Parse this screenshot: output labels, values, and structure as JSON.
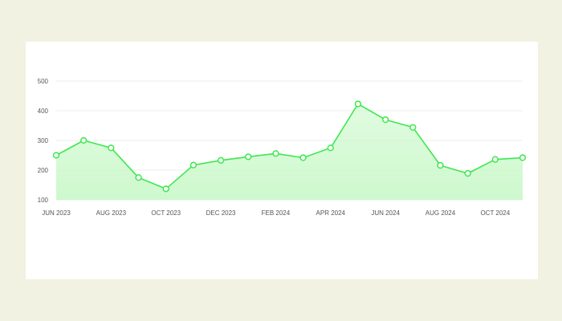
{
  "chart_data": {
    "type": "area",
    "title": "",
    "xlabel": "",
    "ylabel": "",
    "x": [
      "JUN 2023",
      "JUL 2023",
      "AUG 2023",
      "SEP 2023",
      "OCT 2023",
      "NOV 2023",
      "DEC 2023",
      "JAN 2024",
      "FEB 2024",
      "MAR 2024",
      "APR 2024",
      "MAY 2024",
      "JUN 2024",
      "JUL 2024",
      "AUG 2024",
      "SEP 2024",
      "OCT 2024",
      "NOV 2024"
    ],
    "values": [
      250,
      300,
      275,
      175,
      137,
      217,
      233,
      245,
      256,
      242,
      275,
      423,
      370,
      344,
      216,
      189,
      236,
      242
    ],
    "ylim": [
      100,
      500
    ],
    "yticks": [
      100,
      200,
      300,
      400,
      500
    ],
    "xtick_labels": [
      "JUN 2023",
      "AUG 2023",
      "OCT 2023",
      "DEC 2023",
      "FEB 2024",
      "APR 2024",
      "JUN 2024",
      "AUG 2024",
      "OCT 2024"
    ],
    "grid": true,
    "colors": {
      "line": "#3de84f",
      "fill_top": "#c8f8c8",
      "fill_bottom": "#eefdee",
      "marker_fill": "#ffffff"
    }
  }
}
